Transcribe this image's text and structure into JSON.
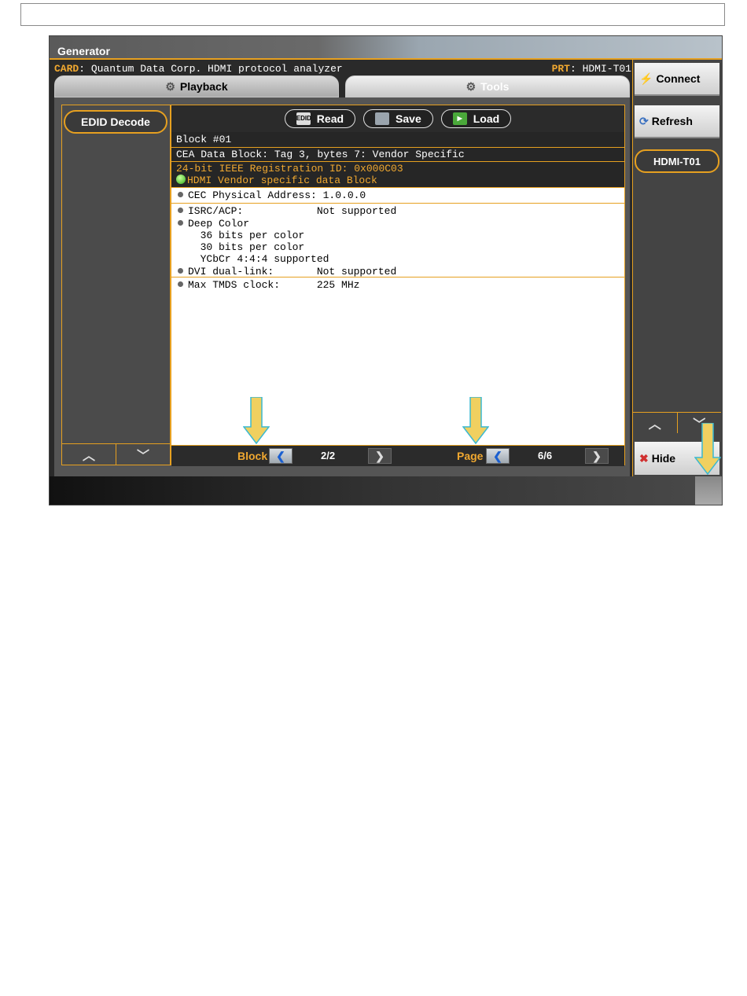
{
  "window": {
    "title": "Generator"
  },
  "card": {
    "label": "CARD",
    "value": "Quantum Data Corp. HDMI protocol analyzer",
    "port_label": "PRT",
    "port_value": "HDMI-T01"
  },
  "tabs": [
    {
      "label": "Playback"
    },
    {
      "label": "Tools"
    }
  ],
  "left_panel": {
    "button": "EDID Decode",
    "up": "^",
    "down": "v"
  },
  "toolbar": {
    "read": "Read",
    "save": "Save",
    "load": "Load",
    "read_icon": "EDID"
  },
  "block_header": "Block #01",
  "cea_header": "CEA Data Block: Tag 3, bytes 7: Vendor Specific",
  "ieee": {
    "line1": "24-bit IEEE Registration ID: 0x000C03",
    "line2": "HDMI Vendor specific data Block"
  },
  "details": {
    "cec": "CEC Physical Address: 1.0.0.0",
    "isrc": "ISRC/ACP:            Not supported",
    "deep_color": "Deep Color",
    "dc36": "  36 bits per color",
    "dc30": "  30 bits per color",
    "ycbcr": "  YCbCr 4:4:4 supported",
    "dvi": "DVI dual-link:       Not supported",
    "tmds": "Max TMDS clock:      225 MHz"
  },
  "nav": {
    "block_label": "Block",
    "block_value": "2/2",
    "page_label": "Page",
    "page_value": "6/6"
  },
  "right_panel": {
    "connect": "Connect",
    "refresh": "Refresh",
    "port_button": "HDMI-T01",
    "hide": "Hide"
  },
  "colors": {
    "accent": "#e6a020",
    "arrow_fill": "#f0d060",
    "arrow_stroke": "#3ab8d0"
  }
}
